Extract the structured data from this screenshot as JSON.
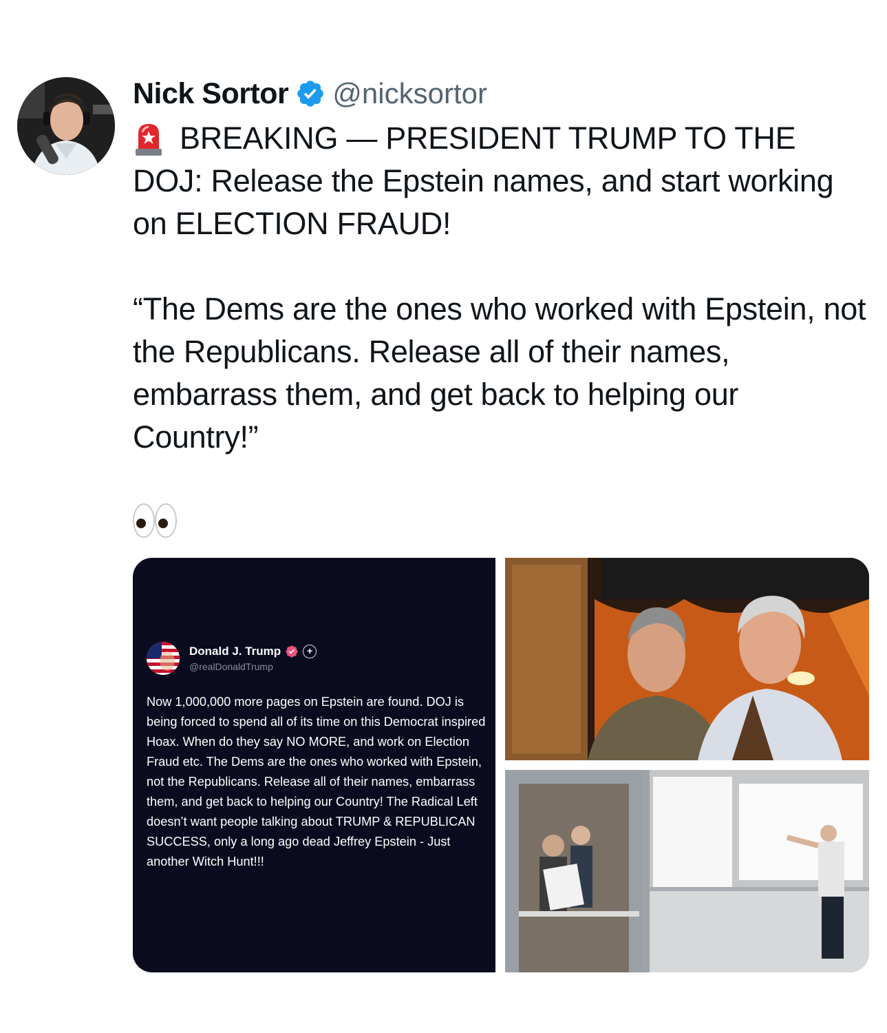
{
  "author": {
    "display_name": "Nick Sortor",
    "handle": "@nicksortor",
    "verified_badge_icon": "verified-check-icon",
    "verified_color": "#1d9bf0"
  },
  "tweet": {
    "line1_emoji_icon": "police-siren-icon",
    "paragraph1": "BREAKING — PRESIDENT TRUMP TO THE DOJ: Release the Epstein names, and start working on ELECTION FRAUD!",
    "paragraph2": "“The Dems are the ones who worked with Epstein, not the Republicans. Release all of their names, embarrass them, and get back to helping our Country!”",
    "trailing_emoji_icon": "eyes-icon"
  },
  "embedded_post": {
    "display_name": "Donald J. Trump",
    "handle": "@realDonaldTrump",
    "badge_icon": "verified-badge-icon",
    "follow_icon": "plus-icon",
    "follow_symbol": "+",
    "text": "Now 1,000,000 more pages on Epstein are found. DOJ is being forced to spend all of its time on this Democrat inspired Hoax. When do they say NO MORE, and work on Election Fraud etc. The Dems are the ones who worked with Epstein, not the Republicans. Release all of their names, embarrass them, and get back to helping our Country! The Radical Left doesn’t want people talking about TRUMP & REPUBLICAN SUCCESS, only a long ago dead Jeffrey Epstein - Just another Witch Hunt!!!"
  },
  "colors": {
    "text_primary": "#0f1419",
    "text_secondary": "#536471",
    "embed_background": "#0b0b1f",
    "embed_badge": "#e8547a"
  }
}
